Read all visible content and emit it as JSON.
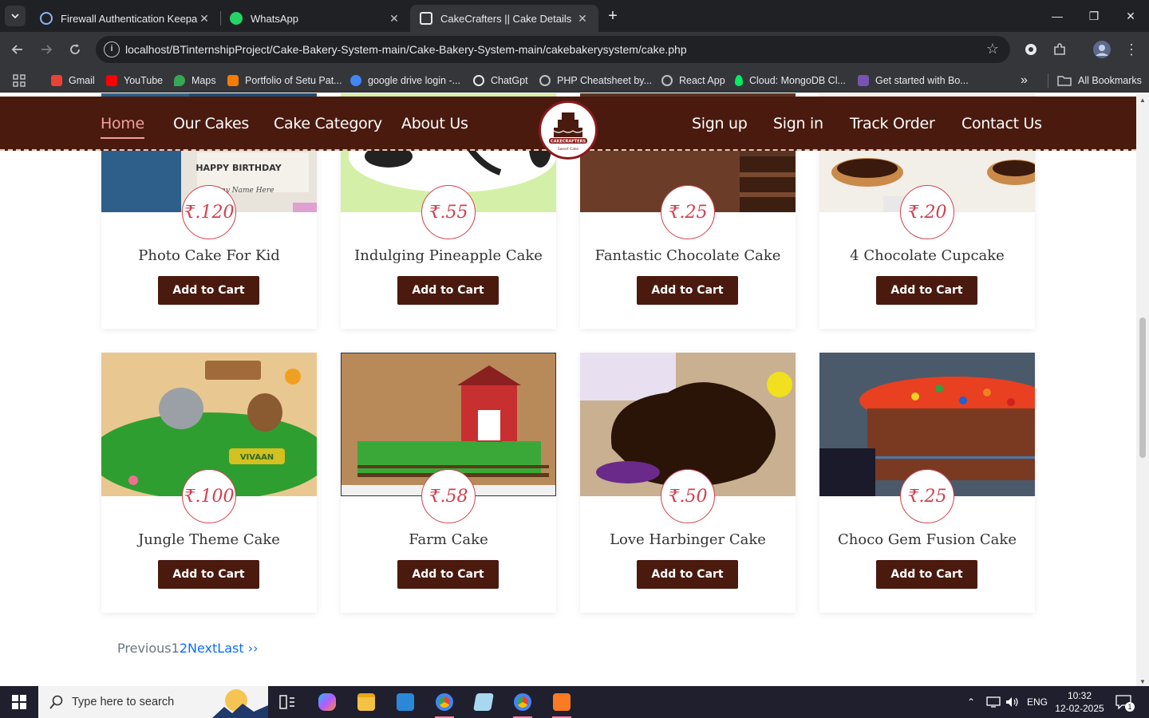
{
  "browser": {
    "tabs": [
      {
        "title": "Firewall Authentication Keepaliv",
        "favicon_color": "#8ab4f8"
      },
      {
        "title": "WhatsApp",
        "favicon_color": "#25d366"
      },
      {
        "title": "CakeCrafters || Cake Details",
        "favicon_color": "#e8eaed"
      }
    ],
    "new_tab": "+",
    "url": "localhost/BTinternshipProject/Cake-Bakery-System-main/Cake-Bakery-System-main/cakebakerysystem/cake.php",
    "bookmarks": [
      {
        "label": "Gmail",
        "color": "#ea4335"
      },
      {
        "label": "YouTube",
        "color": "#ff0000"
      },
      {
        "label": "Maps",
        "color": "#34a853"
      },
      {
        "label": "Portfolio of Setu Pat...",
        "color": "#f57c00"
      },
      {
        "label": "google drive login -...",
        "color": "#4285f4"
      },
      {
        "label": "ChatGpt",
        "color": "#e8eaed"
      },
      {
        "label": "PHP Cheatsheet by...",
        "color": "#bdc1c6"
      },
      {
        "label": "React App",
        "color": "#bdc1c6"
      },
      {
        "label": "Cloud: MongoDB Cl...",
        "color": "#00ed64"
      },
      {
        "label": "Get started with Bo...",
        "color": "#7952b3"
      }
    ],
    "more_bookmarks": "»",
    "all_bookmarks": "All Bookmarks"
  },
  "site": {
    "nav_left": [
      "Home",
      "Our Cakes",
      "Cake Category",
      "About Us"
    ],
    "nav_right": [
      "Sign up",
      "Sign in",
      "Track Order",
      "Contact Us"
    ],
    "logo_text": "CAKECRAFTERS",
    "logo_sub": "Sweet Cake",
    "colors": {
      "brand": "#4a1a0f",
      "accent": "#d04050"
    }
  },
  "cakes": [
    {
      "name": "Photo Cake For Kid",
      "price": "₹.120",
      "button": "Add to Cart"
    },
    {
      "name": "Indulging Pineapple Cake",
      "price": "₹.55",
      "button": "Add to Cart"
    },
    {
      "name": "Fantastic Chocolate Cake",
      "price": "₹.25",
      "button": "Add to Cart"
    },
    {
      "name": "4 Chocolate Cupcake",
      "price": "₹.20",
      "button": "Add to Cart"
    },
    {
      "name": "Jungle Theme Cake",
      "price": "₹.100",
      "button": "Add to Cart"
    },
    {
      "name": "Farm Cake",
      "price": "₹.58",
      "button": "Add to Cart"
    },
    {
      "name": "Love Harbinger Cake",
      "price": "₹.50",
      "button": "Add to Cart"
    },
    {
      "name": "Choco Gem Fusion Cake",
      "price": "₹.25",
      "button": "Add to Cart"
    }
  ],
  "cake_image_text": {
    "birthday": "HAPPY BIRTHDAY",
    "any_name": "Any Name Here",
    "vivaan": "VIVAAN"
  },
  "pagination": {
    "previous": "Previous",
    "page1": "1",
    "page2": "2",
    "next": "Next",
    "last": "Last ››"
  },
  "taskbar": {
    "search_placeholder": "Type here to search",
    "language": "ENG",
    "time": "10:32",
    "date": "12-02-2025",
    "notification_count": "1"
  }
}
